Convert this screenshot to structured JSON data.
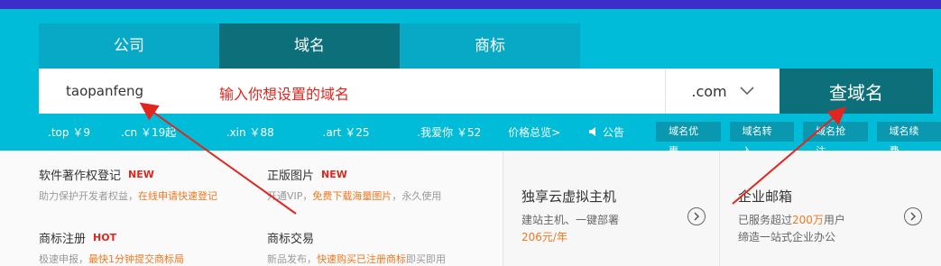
{
  "tabs": [
    {
      "label": "公司"
    },
    {
      "label": "域名"
    },
    {
      "label": "商标"
    }
  ],
  "search": {
    "value": "taopanfeng",
    "hint": "输入你想设置的域名",
    "tld": ".com",
    "button": "查域名"
  },
  "prices": [
    {
      "tld": ".top",
      "price": "￥9"
    },
    {
      "tld": ".cn",
      "price": "￥19起"
    },
    {
      "tld": ".xin",
      "price": "￥88"
    },
    {
      "tld": ".art",
      "price": "￥25"
    },
    {
      "tld": ".我爱你",
      "price": "￥52"
    }
  ],
  "overview": "价格总览>",
  "notice": "公告",
  "chips": [
    "域名优惠",
    "域名转入",
    "域名抢注",
    "域名续费"
  ],
  "services": [
    {
      "title": "软件著作权登记",
      "badge": "NEW",
      "desc_prefix": "助力保护开发者权益，",
      "desc_highlight": "在线申请快速登记",
      "desc_suffix": ""
    },
    {
      "title": "正版图片",
      "badge": "NEW",
      "desc_prefix": "开通VIP，",
      "desc_highlight": "免费下载海量图片",
      "desc_suffix": "，永久使用"
    },
    {
      "title": "商标注册",
      "badge": "HOT",
      "desc_prefix": "极速申报，",
      "desc_highlight": "最快1分钟提交商标局",
      "desc_suffix": ""
    },
    {
      "title": "商标交易",
      "badge": "",
      "desc_prefix": "新品发布，",
      "desc_highlight": "快速购买已注册商标",
      "desc_suffix": "即买即用"
    }
  ],
  "cards": [
    {
      "title": "独享云虚拟主机",
      "line1": "建站主机、一键部署",
      "price": "206元/年"
    },
    {
      "title": "企业邮箱",
      "line1_prefix": "已服务超过",
      "line1_highlight": "200万",
      "line1_suffix": "用户",
      "line2": "缔造一站式企业办公"
    }
  ],
  "colors": {
    "hero": "#00bcd8",
    "active_tab": "#0c6f7a",
    "accent_red": "#e0261f",
    "accent_orange": "#f27820"
  }
}
